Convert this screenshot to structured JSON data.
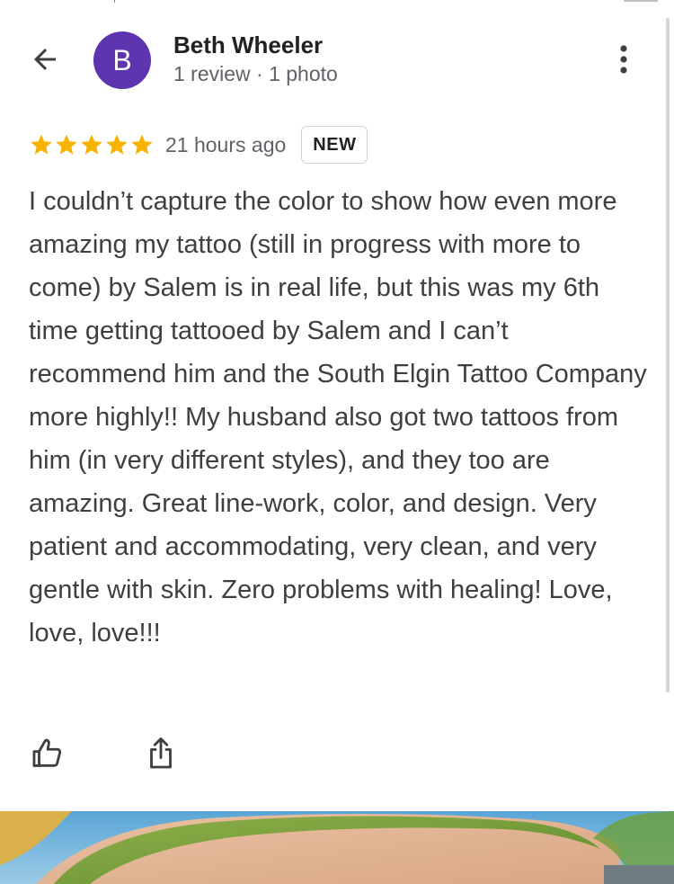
{
  "header": {
    "reviewer_name": "Beth Wheeler",
    "reviewer_meta": "1 review · 1 photo",
    "avatar_letter": "B",
    "avatar_color": "#5e35b1"
  },
  "review": {
    "rating": 5,
    "max_rating": 5,
    "time_ago": "21 hours ago",
    "badge": "NEW",
    "text": "I couldn’t capture the color to show how even more amazing my tattoo (still in progress with more to come) by Salem is in real life, but this was my 6th time getting tattooed by Salem and I can’t recommend him and the South Elgin Tattoo Company more highly!! My husband also got two tattoos from him (in very different styles), and they too are amazing. Great line-work, color, and design. Very patient and accommodating, very clean, and very gentle with skin. Zero problems with healing! Love, love, love!!!"
  },
  "icons": {
    "back": "arrow-back-icon",
    "more": "more-vert-icon",
    "star": "star-icon",
    "like": "thumb-up-icon",
    "share": "share-icon"
  },
  "colors": {
    "star": "#f6b400",
    "name": "#202124",
    "meta": "#5f6368",
    "body": "#3c4043",
    "badge_border": "#cfd2d6"
  }
}
